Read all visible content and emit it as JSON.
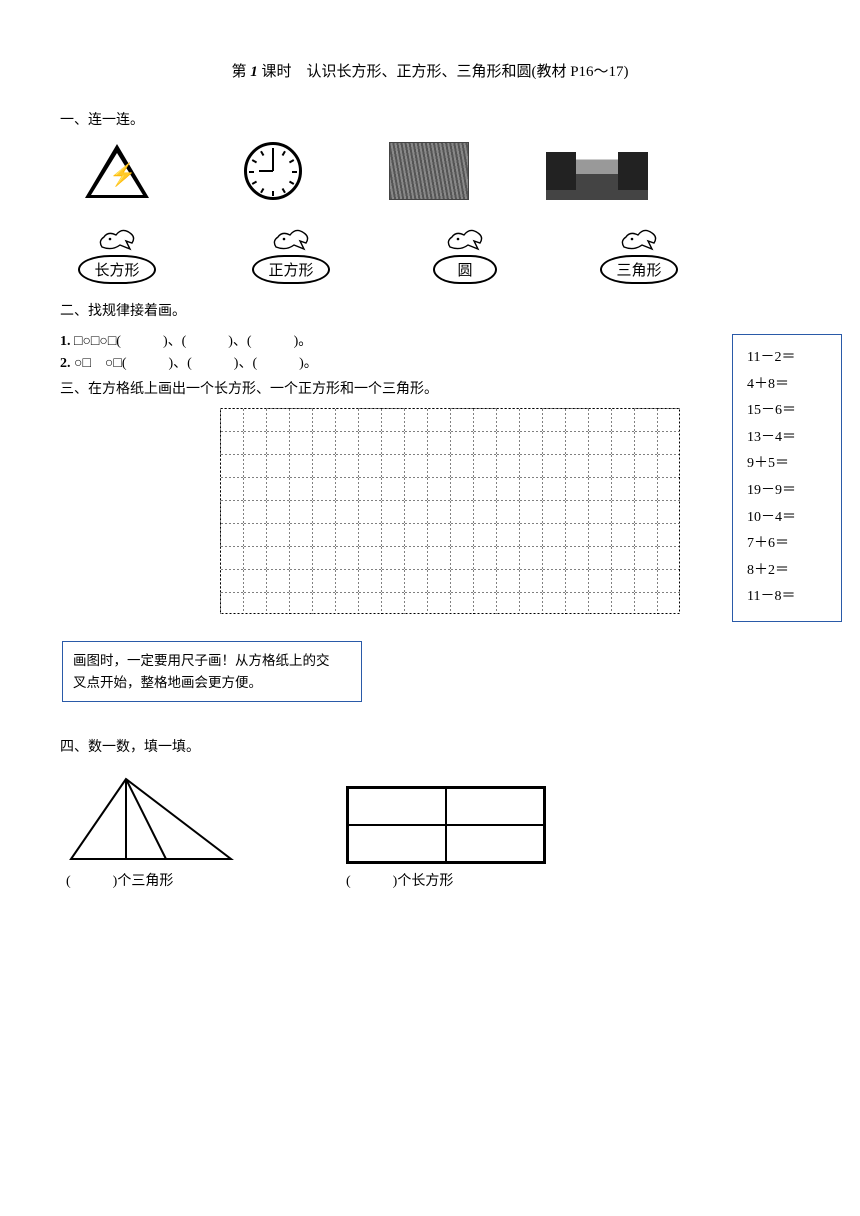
{
  "title_prefix": "第",
  "title_num": "1",
  "title_mid": "课时　认识长方形、正方形、三角形和圆(教材 P16～17)",
  "sec1_head": "一、连一连。",
  "labels": {
    "rect": "长方形",
    "square": "正方形",
    "circle": "圆",
    "triangle": "三角形"
  },
  "sec2_head": "二、找规律接着画。",
  "p1_num": "1.",
  "p1_body": "□○□○□(　　　)、(　　　)、(　　　)。",
  "p2_num": "2.",
  "p2_body": "○□　○□(　　　)、(　　　)、(　　　)。",
  "sec3_head": "三、在方格纸上画出一个长方形、一个正方形和一个三角形。",
  "tip_line1": "画图时，一定要用尺子画！从方格纸上的交",
  "tip_line2": "叉点开始，整格地画会更方便。",
  "sidebar_problems": [
    "11－2＝",
    "4＋8＝",
    "15－6＝",
    "13－4＝",
    "9＋5＝",
    "19－9＝",
    "10－4＝",
    "7＋6＝",
    "8＋2＝",
    "11－8＝"
  ],
  "sec4_head": "四、数一数，填一填。",
  "cap_tri": "(　　　)个三角形",
  "cap_rect": "(　　　)个长方形"
}
